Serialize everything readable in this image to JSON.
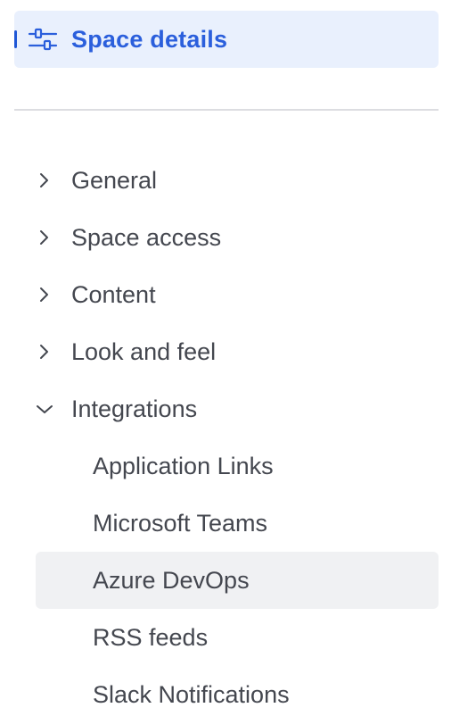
{
  "header": {
    "title": "Space details",
    "icon": "sliders-icon",
    "accent_color": "#2b5fdc",
    "background_color": "#e9f0fd"
  },
  "nav": {
    "items": [
      {
        "label": "General",
        "icon": "chevron-right-icon",
        "expanded": false
      },
      {
        "label": "Space access",
        "icon": "chevron-right-icon",
        "expanded": false
      },
      {
        "label": "Content",
        "icon": "chevron-right-icon",
        "expanded": false
      },
      {
        "label": "Look and feel",
        "icon": "chevron-right-icon",
        "expanded": false
      },
      {
        "label": "Integrations",
        "icon": "chevron-down-icon",
        "expanded": true
      }
    ],
    "integrations": [
      {
        "label": "Application Links",
        "selected": false
      },
      {
        "label": "Microsoft Teams",
        "selected": false
      },
      {
        "label": "Azure DevOps",
        "selected": true
      },
      {
        "label": "RSS feeds",
        "selected": false
      },
      {
        "label": "Slack Notifications",
        "selected": false
      }
    ]
  }
}
